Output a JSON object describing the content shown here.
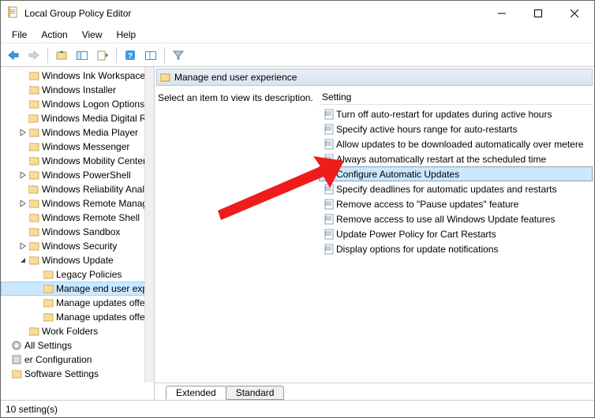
{
  "window": {
    "title": "Local Group Policy Editor",
    "minimize": "—",
    "maximize": "☐",
    "close": "✕"
  },
  "menu": {
    "file": "File",
    "action": "Action",
    "view": "View",
    "help": "Help"
  },
  "tree": {
    "items": [
      {
        "indent": 22,
        "label": "Windows Ink Workspace"
      },
      {
        "indent": 22,
        "label": "Windows Installer"
      },
      {
        "indent": 22,
        "label": "Windows Logon Options"
      },
      {
        "indent": 22,
        "label": "Windows Media Digital Rig"
      },
      {
        "indent": 22,
        "label": "Windows Media Player",
        "exp": ">"
      },
      {
        "indent": 22,
        "label": "Windows Messenger"
      },
      {
        "indent": 22,
        "label": "Windows Mobility Center"
      },
      {
        "indent": 22,
        "label": "Windows PowerShell",
        "exp": ">"
      },
      {
        "indent": 22,
        "label": "Windows Reliability Analys"
      },
      {
        "indent": 22,
        "label": "Windows Remote Manage",
        "exp": ">"
      },
      {
        "indent": 22,
        "label": "Windows Remote Shell"
      },
      {
        "indent": 22,
        "label": "Windows Sandbox"
      },
      {
        "indent": 22,
        "label": "Windows Security",
        "exp": ">"
      },
      {
        "indent": 22,
        "label": "Windows Update",
        "exp": "v"
      },
      {
        "indent": 40,
        "label": "Legacy Policies"
      },
      {
        "indent": 40,
        "label": "Manage end user expe",
        "sel": true
      },
      {
        "indent": 40,
        "label": "Manage updates offere"
      },
      {
        "indent": 40,
        "label": "Manage updates offere"
      },
      {
        "indent": 22,
        "label": "Work Folders"
      },
      {
        "indent": 0,
        "label": "All Settings",
        "gear": true
      }
    ],
    "cut1": "er Configuration",
    "cut2": "Software Settings"
  },
  "detail": {
    "header": "Manage end user experience",
    "description": "Select an item to view its description.",
    "columnHeader": "Setting",
    "settings": [
      "Turn off auto-restart for updates during active hours",
      "Specify active hours range for auto-restarts",
      "Allow updates to be downloaded automatically over metere",
      "Always automatically restart at the scheduled time",
      "Configure Automatic Updates",
      "Specify deadlines for automatic updates and restarts",
      "Remove access to \"Pause updates\" feature",
      "Remove access to use all Windows Update features",
      "Update Power Policy for Cart Restarts",
      "Display options for update notifications"
    ],
    "selectedIndex": 4,
    "tabs": {
      "extended": "Extended",
      "standard": "Standard"
    }
  },
  "status": {
    "text": "10 setting(s)"
  }
}
